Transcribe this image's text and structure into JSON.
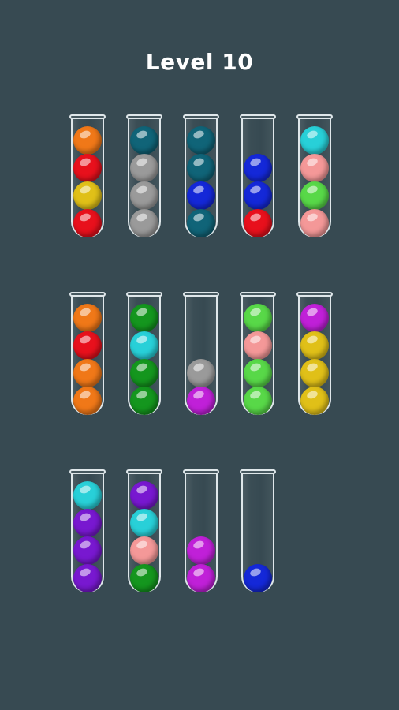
{
  "header": {
    "title": "Level 10"
  },
  "colors": {
    "orange": "#f07818",
    "red": "#e8101c",
    "yellow": "#e0c018",
    "teal": "#106478",
    "gray": "#9a9a9a",
    "blue": "#1428d8",
    "cyan": "#28d0d8",
    "pink": "#f49898",
    "lightgreen": "#58d848",
    "green": "#14961e",
    "magenta": "#c020d8",
    "purple": "#7818d0"
  },
  "tubes": [
    {
      "balls": [
        "orange",
        "red",
        "yellow",
        "red"
      ]
    },
    {
      "balls": [
        "teal",
        "gray",
        "gray",
        "gray"
      ]
    },
    {
      "balls": [
        "teal",
        "teal",
        "blue",
        "teal"
      ]
    },
    {
      "balls": [
        "blue",
        "blue",
        "red"
      ]
    },
    {
      "balls": [
        "cyan",
        "pink",
        "lightgreen",
        "pink"
      ]
    },
    {
      "balls": [
        "orange",
        "red",
        "orange",
        "orange"
      ]
    },
    {
      "balls": [
        "green",
        "cyan",
        "green",
        "green"
      ]
    },
    {
      "balls": [
        "gray",
        "magenta"
      ]
    },
    {
      "balls": [
        "lightgreen",
        "pink",
        "lightgreen",
        "lightgreen"
      ]
    },
    {
      "balls": [
        "magenta",
        "yellow",
        "yellow",
        "yellow"
      ]
    },
    {
      "balls": [
        "cyan",
        "purple",
        "purple",
        "purple"
      ]
    },
    {
      "balls": [
        "purple",
        "cyan",
        "pink",
        "green"
      ]
    },
    {
      "balls": [
        "magenta",
        "magenta"
      ]
    },
    {
      "balls": [
        "blue"
      ]
    }
  ]
}
